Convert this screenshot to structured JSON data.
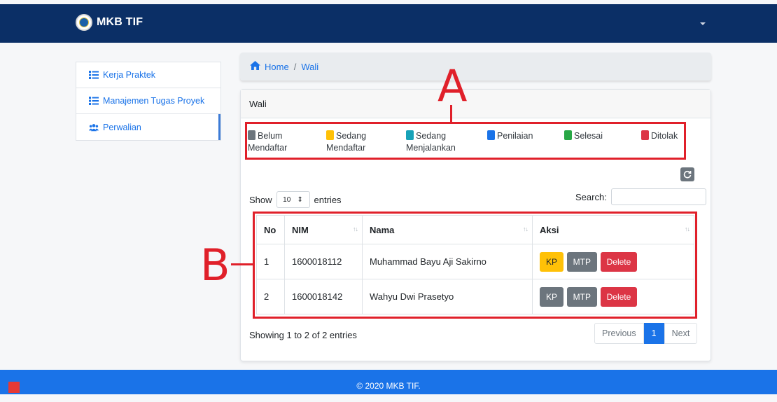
{
  "navbar": {
    "brand": "MKB TIF",
    "colors": {
      "background": "#0b2f66"
    }
  },
  "sidebar": {
    "items": [
      {
        "label": "Kerja Praktek",
        "icon": "list-icon"
      },
      {
        "label": "Manajemen Tugas Proyek",
        "icon": "list-icon"
      },
      {
        "label": "Perwalian",
        "icon": "users-icon",
        "active": true
      }
    ]
  },
  "breadcrumb": {
    "home": "Home",
    "separator": "/",
    "current": "Wali"
  },
  "card": {
    "title": "Wali"
  },
  "legend": [
    {
      "label_line1": "Belum",
      "label_line2": "Mendaftar",
      "color": "#6c757d"
    },
    {
      "label_line1": "Sedang",
      "label_line2": "Mendaftar",
      "color": "#ffc107"
    },
    {
      "label_line1": "Sedang",
      "label_line2": "Menjalankan",
      "color": "#17a2b8"
    },
    {
      "label_line1": "Penilaian",
      "label_line2": "",
      "color": "#1a73e8"
    },
    {
      "label_line1": "Selesai",
      "label_line2": "",
      "color": "#28a745"
    },
    {
      "label_line1": "Ditolak",
      "label_line2": "",
      "color": "#dc3545"
    }
  ],
  "controls": {
    "show": "Show",
    "page_size": "10",
    "entries": "entries",
    "search_label": "Search:"
  },
  "table": {
    "headers": [
      "No",
      "NIM",
      "Nama",
      "Aksi"
    ],
    "rows": [
      {
        "no": "1",
        "nim": "1600018112",
        "nama": "Muhammad Bayu Aji Sakirno",
        "kp": "KP",
        "mtp": "MTP",
        "delete": "Delete"
      },
      {
        "no": "2",
        "nim": "1600018142",
        "nama": "Wahyu Dwi Prasetyo",
        "kp": "KP",
        "mtp": "MTP",
        "delete": "Delete"
      }
    ]
  },
  "info": "Showing 1 to 2 of 2 entries",
  "pagination": {
    "previous": "Previous",
    "current": "1",
    "next": "Next"
  },
  "footer": {
    "text": "© 2020 MKB TIF."
  },
  "annotations": {
    "a": "A",
    "b": "B",
    "color": "#e0202a"
  }
}
